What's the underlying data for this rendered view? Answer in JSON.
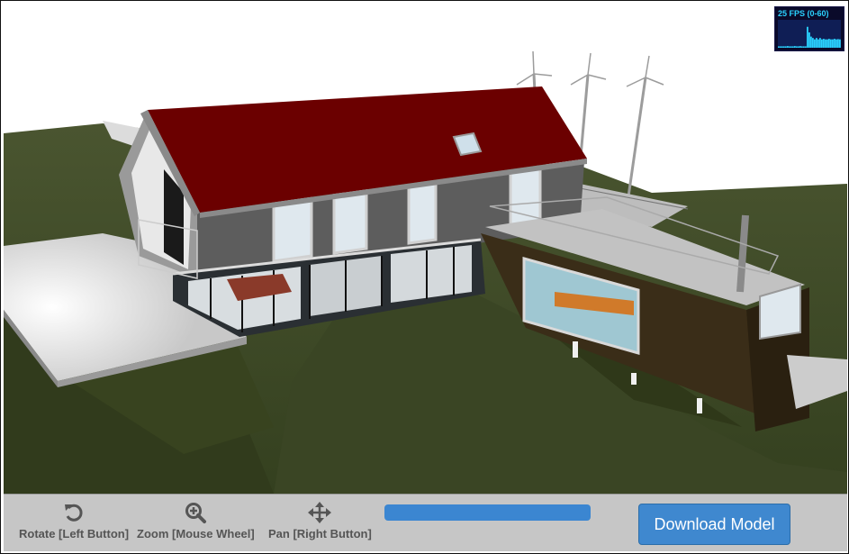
{
  "fps_meter": {
    "label": "25 FPS (0-60)",
    "current_fps": 25,
    "range": [
      0,
      60
    ],
    "history": [
      0.05,
      0.05,
      0.05,
      0.05,
      0.05,
      0.06,
      0.05,
      0.05,
      0.05,
      0.06,
      0.05,
      0.05,
      0.06,
      0.05,
      0.05,
      0.05,
      0.75,
      0.55,
      0.4,
      0.35,
      0.3,
      0.35,
      0.3,
      0.35,
      0.3,
      0.32,
      0.3,
      0.3,
      0.32,
      0.3,
      0.3,
      0.32,
      0.3,
      0.31,
      0.3
    ]
  },
  "toolbar": {
    "rotate_label": "Rotate [Left Button]",
    "zoom_label": "Zoom [Mouse Wheel]",
    "pan_label": "Pan [Right Button]",
    "rotate_icon": "rotate-icon",
    "zoom_icon": "zoom-in-icon",
    "pan_icon": "move-icon",
    "download_label": "Download Model",
    "progress": 1.0
  },
  "colors": {
    "roof": "#6b0000",
    "terrain": "#3f4a28",
    "button": "#3f88cf",
    "toolbar_bg": "#c6c6c6",
    "fps_text": "#2ad2ff"
  }
}
